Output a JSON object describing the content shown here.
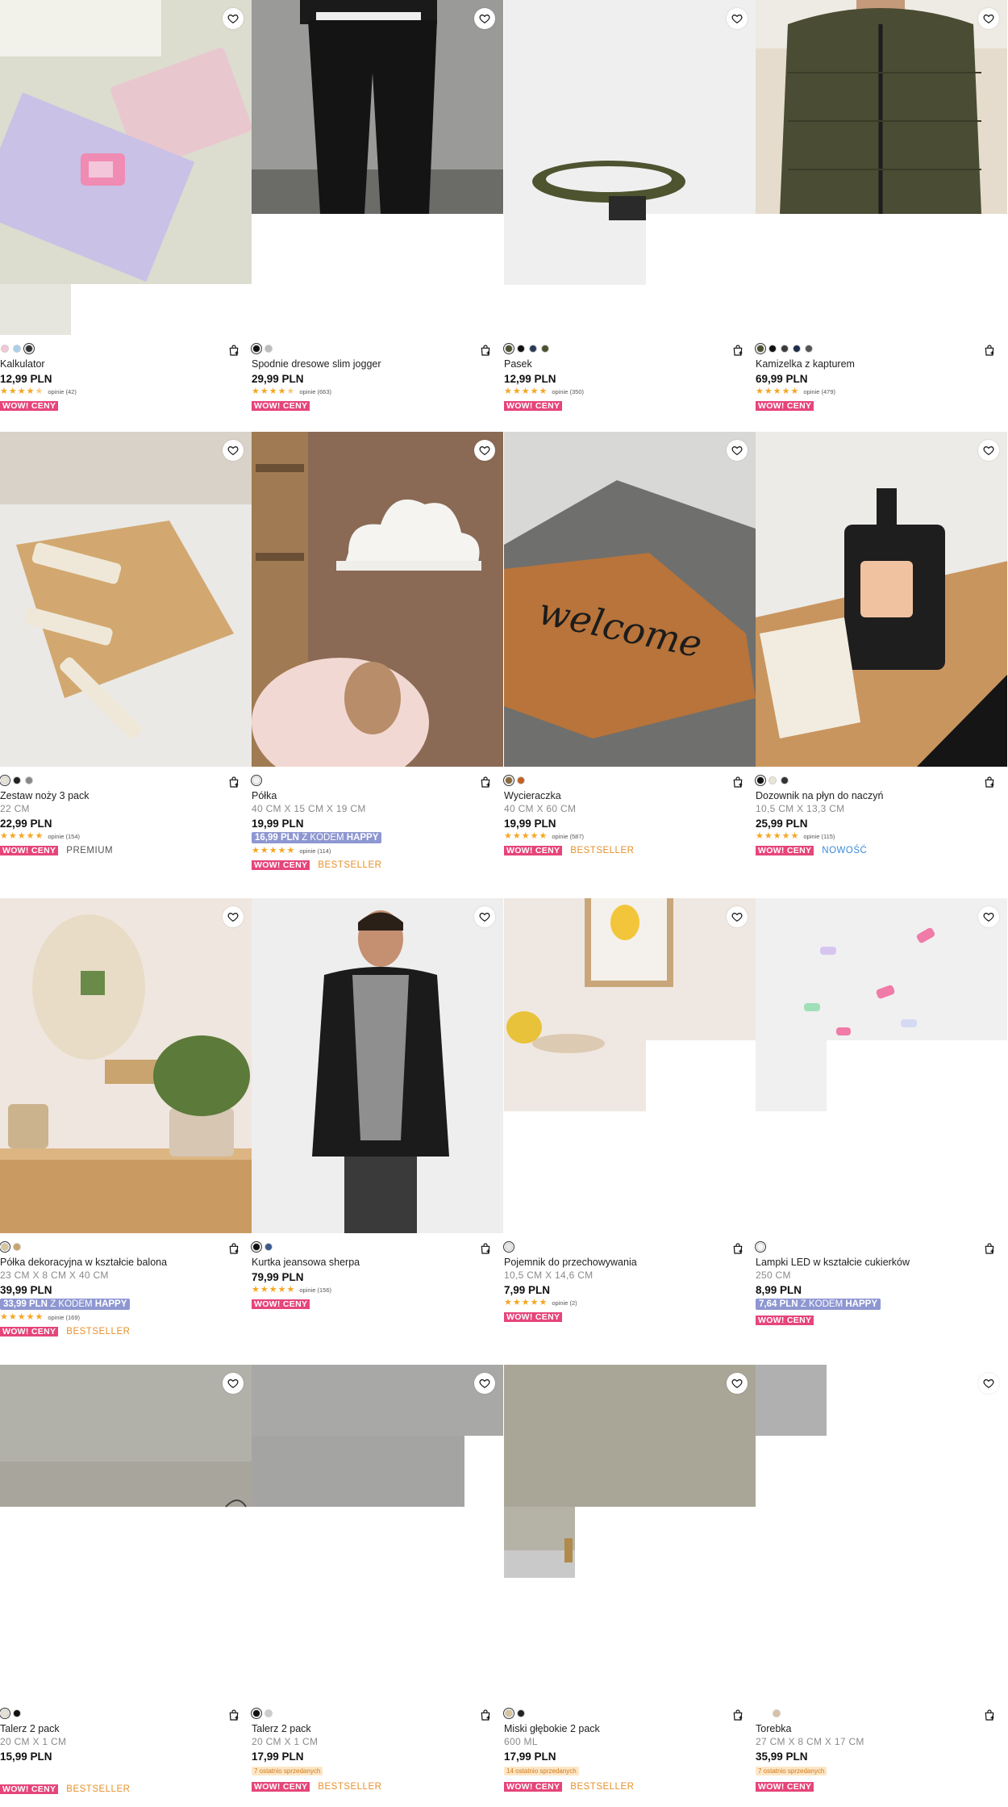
{
  "products": [
    {
      "name": "Kalkulator",
      "dims": "",
      "price": "12,99 PLN",
      "code_price": "",
      "code_text": "",
      "code_name": "",
      "opinie": "opinie (42)",
      "wow": "WOW! CENY",
      "tag": "",
      "recent": "",
      "swatches": [
        "#f5c6d4",
        "#a8d0ee",
        "#333333"
      ]
    },
    {
      "name": "Spodnie dresowe slim jogger",
      "dims": "",
      "price": "29,99 PLN",
      "code_price": "",
      "code_text": "",
      "code_name": "",
      "opinie": "opinie (663)",
      "wow": "WOW! CENY",
      "tag": "",
      "recent": "",
      "swatches": [
        "#111111",
        "#bbbbbb"
      ]
    },
    {
      "name": "Pasek",
      "dims": "",
      "price": "12,99 PLN",
      "code_price": "",
      "code_text": "",
      "code_name": "",
      "opinie": "opinie (350)",
      "wow": "WOW! CENY",
      "tag": "",
      "recent": "",
      "swatches": [
        "#4a5230",
        "#111111",
        "#2a3a55",
        "#4a5230"
      ]
    },
    {
      "name": "Kamizelka z kapturem",
      "dims": "",
      "price": "69,99 PLN",
      "code_price": "",
      "code_text": "",
      "code_name": "",
      "opinie": "opinie (479)",
      "wow": "WOW! CENY",
      "tag": "",
      "recent": "",
      "swatches": [
        "#4a5230",
        "#111111",
        "#3b3b3b",
        "#1f2d4a",
        "#555555"
      ]
    },
    {
      "name": "Zestaw noży 3 pack",
      "dims": "22 CM",
      "price": "22,99 PLN",
      "code_price": "",
      "code_text": "",
      "code_name": "",
      "opinie": "opinie (154)",
      "wow": "WOW! CENY",
      "tag": "PREMIUM",
      "recent": "",
      "swatches": [
        "#e6e1d2",
        "#222222",
        "#888888"
      ]
    },
    {
      "name": "Półka",
      "dims": "40 CM X 15 CM X 19 CM",
      "price": "19,99 PLN",
      "code_price": "16,99 PLN",
      "code_text": "Z KODEM",
      "code_name": "HAPPY",
      "opinie": "opinie (114)",
      "wow": "WOW! CENY",
      "tag": "BESTSELLER",
      "recent": "",
      "swatches": [
        "#f2f2f2"
      ]
    },
    {
      "name": "Wycieraczka",
      "dims": "40 CM X 60 CM",
      "price": "19,99 PLN",
      "code_price": "",
      "code_text": "",
      "code_name": "",
      "opinie": "opinie (587)",
      "wow": "WOW! CENY",
      "tag": "BESTSELLER",
      "recent": "",
      "swatches": [
        "#8a6a3a",
        "#c4601f"
      ]
    },
    {
      "name": "Dozownik na płyn do naczyń",
      "dims": "10,5 CM X 13,3 CM",
      "price": "25,99 PLN",
      "code_price": "",
      "code_text": "",
      "code_name": "",
      "opinie": "opinie (115)",
      "wow": "WOW! CENY",
      "tag": "NOWOŚĆ",
      "recent": "",
      "swatches": [
        "#111111",
        "#e8e4d6",
        "#333333"
      ]
    },
    {
      "name": "Półka dekoracyjna w kształcie balona",
      "dims": "23 CM X 8 CM X 40 CM",
      "price": "39,99 PLN",
      "code_price": "33,99 PLN",
      "code_text": "Z KODEM",
      "code_name": "HAPPY",
      "opinie": "opinie (169)",
      "wow": "WOW! CENY",
      "tag": "BESTSELLER",
      "recent": "",
      "swatches": [
        "#d8c39a",
        "#c9a46e"
      ]
    },
    {
      "name": "Kurtka jeansowa sherpa",
      "dims": "",
      "price": "79,99 PLN",
      "code_price": "",
      "code_text": "",
      "code_name": "",
      "opinie": "opinie (156)",
      "wow": "WOW! CENY",
      "tag": "",
      "recent": "",
      "swatches": [
        "#111111",
        "#3a5a8a"
      ]
    },
    {
      "name": "Pojemnik do przechowywania",
      "dims": "10,5 CM X 14,6 CM",
      "price": "7,99 PLN",
      "code_price": "",
      "code_text": "",
      "code_name": "",
      "opinie": "opinie (2)",
      "wow": "WOW! CENY",
      "tag": "",
      "recent": "",
      "swatches": [
        "#e6e6e6"
      ]
    },
    {
      "name": "Lampki LED w kształcie cukierków",
      "dims": "250 CM",
      "price": "8,99 PLN",
      "code_price": "7,64 PLN",
      "code_text": "Z KODEM",
      "code_name": "HAPPY",
      "opinie": "",
      "wow": "WOW! CENY",
      "tag": "",
      "recent": "",
      "swatches": [
        "#f7f7f7"
      ]
    },
    {
      "name": "Talerz 2 pack",
      "dims": "20 CM X 1 CM",
      "price": "15,99 PLN",
      "code_price": "",
      "code_text": "",
      "code_name": "",
      "opinie": "",
      "wow": "WOW! CENY",
      "tag": "BESTSELLER",
      "recent": "",
      "swatches": [
        "#e6e1d2",
        "#111111"
      ]
    },
    {
      "name": "Talerz 2 pack",
      "dims": "20 CM X 1 CM",
      "price": "17,99 PLN",
      "code_price": "",
      "code_text": "",
      "code_name": "",
      "opinie": "",
      "wow": "WOW! CENY",
      "tag": "BESTSELLER",
      "recent": "7 ostatnio sprzedanych",
      "swatches": [
        "#111111",
        "#cccccc"
      ]
    },
    {
      "name": "Miski głębokie 2 pack",
      "dims": "600 ML",
      "price": "17,99 PLN",
      "code_price": "",
      "code_text": "",
      "code_name": "",
      "opinie": "",
      "wow": "WOW! CENY",
      "tag": "BESTSELLER",
      "recent": "14 ostatnio sprzedanych",
      "swatches": [
        "#d8c39a",
        "#222222"
      ]
    },
    {
      "name": "Torebka",
      "dims": "27 CM X 8 CM X 17 CM",
      "price": "35,99 PLN",
      "code_price": "",
      "code_text": "",
      "code_name": "",
      "opinie": "",
      "wow": "WOW! CENY",
      "tag": "",
      "recent": "7 ostatnio sprzedanych",
      "swatches": [
        "#d9c2a3"
      ]
    }
  ],
  "colors": {
    "wow": "#e6457a",
    "bestseller": "#e6912b",
    "nowosc": "#3a8ad8",
    "code": "#8e97d1",
    "star": "#f5a623"
  }
}
